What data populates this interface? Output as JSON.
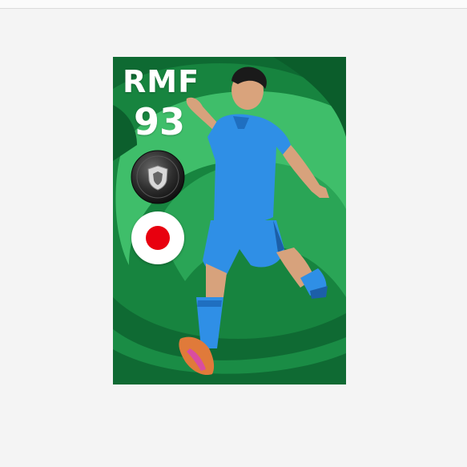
{
  "card": {
    "position": "RMF",
    "rating": "93",
    "badge_icon": "club-shield-badge-icon",
    "nationality_flag": "japan-flag-icon",
    "colors": {
      "card_green": "#1b8a45",
      "swirl_light": "#4cc873",
      "swirl_dark": "#0f6a33",
      "kit_blue": "#2f8fe6",
      "flag_red": "#e8000f"
    }
  }
}
